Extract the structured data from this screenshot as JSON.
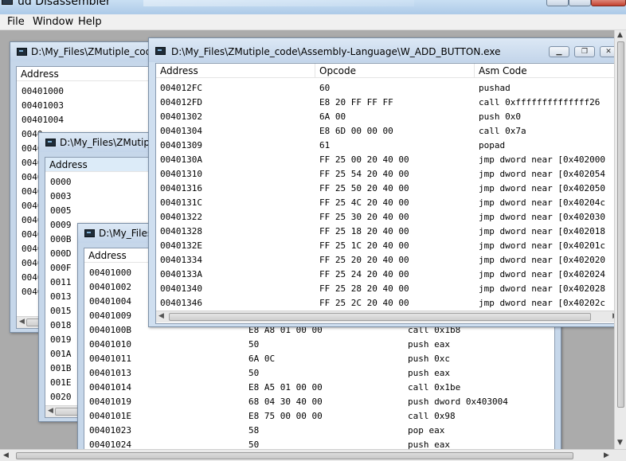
{
  "app": {
    "title": "ud Disassembler"
  },
  "menu": [
    "File",
    "Window",
    "Help"
  ],
  "windows": {
    "w1": {
      "title": "D:\\My_Files\\ZMutiple_code",
      "header": "Address",
      "addresses": [
        "00401000",
        "00401003",
        "00401004",
        "0040",
        "0040",
        "0040",
        "0040",
        "0040",
        "0040",
        "0040",
        "0040",
        "0040",
        "0040",
        "0040",
        "0040"
      ]
    },
    "w2": {
      "title": "D:\\My_Files\\ZMutipl",
      "header": "Address",
      "addresses": [
        "0000",
        "0003",
        "0005",
        "0009",
        "000B",
        "000D",
        "000F",
        "0011",
        "0013",
        "0015",
        "0018",
        "0019",
        "001A",
        "001B",
        "001E",
        "0020"
      ]
    },
    "w3": {
      "title": "D:\\My_Files",
      "header": "Address",
      "rows": [
        {
          "addr": "00401000",
          "op": "",
          "asm": ""
        },
        {
          "addr": "00401002",
          "op": "",
          "asm": ""
        },
        {
          "addr": "00401004",
          "op": "",
          "asm": ""
        },
        {
          "addr": "00401009",
          "op": "",
          "asm": ""
        },
        {
          "addr": "0040100B",
          "op": "E8 A8 01 00 00",
          "asm": "call 0x1b8"
        },
        {
          "addr": "00401010",
          "op": "50",
          "asm": "push eax"
        },
        {
          "addr": "00401011",
          "op": "6A 0C",
          "asm": "push 0xc"
        },
        {
          "addr": "00401013",
          "op": "50",
          "asm": "push eax"
        },
        {
          "addr": "00401014",
          "op": "E8 A5 01 00 00",
          "asm": "call 0x1be"
        },
        {
          "addr": "00401019",
          "op": "68 04 30 40 00",
          "asm": "push dword 0x403004"
        },
        {
          "addr": "0040101E",
          "op": "E8 75 00 00 00",
          "asm": "call 0x98"
        },
        {
          "addr": "00401023",
          "op": "58",
          "asm": "pop eax"
        },
        {
          "addr": "00401024",
          "op": "50",
          "asm": "push eax"
        }
      ]
    },
    "w4": {
      "title": "D:\\My_Files\\ZMutiple_code\\Assembly-Language\\W_ADD_BUTTON.exe",
      "headers": {
        "address": "Address",
        "opcode": "Opcode",
        "asm": "Asm Code"
      },
      "rows": [
        {
          "addr": "004012FC",
          "op": "60",
          "asm": "pushad"
        },
        {
          "addr": "004012FD",
          "op": "E8 20 FF FF FF",
          "asm": "call 0xffffffffffffff26"
        },
        {
          "addr": "00401302",
          "op": "6A 00",
          "asm": "push 0x0"
        },
        {
          "addr": "00401304",
          "op": "E8 6D 00 00 00",
          "asm": "call 0x7a"
        },
        {
          "addr": "00401309",
          "op": "61",
          "asm": "popad"
        },
        {
          "addr": "0040130A",
          "op": "FF 25 00 20 40 00",
          "asm": "jmp dword near [0x402000"
        },
        {
          "addr": "00401310",
          "op": "FF 25 54 20 40 00",
          "asm": "jmp dword near [0x402054"
        },
        {
          "addr": "00401316",
          "op": "FF 25 50 20 40 00",
          "asm": "jmp dword near [0x402050"
        },
        {
          "addr": "0040131C",
          "op": "FF 25 4C 20 40 00",
          "asm": "jmp dword near [0x40204c"
        },
        {
          "addr": "00401322",
          "op": "FF 25 30 20 40 00",
          "asm": "jmp dword near [0x402030"
        },
        {
          "addr": "00401328",
          "op": "FF 25 18 20 40 00",
          "asm": "jmp dword near [0x402018"
        },
        {
          "addr": "0040132E",
          "op": "FF 25 1C 20 40 00",
          "asm": "jmp dword near [0x40201c"
        },
        {
          "addr": "00401334",
          "op": "FF 25 20 20 40 00",
          "asm": "jmp dword near [0x402020"
        },
        {
          "addr": "0040133A",
          "op": "FF 25 24 20 40 00",
          "asm": "jmp dword near [0x402024"
        },
        {
          "addr": "00401340",
          "op": "FF 25 28 20 40 00",
          "asm": "jmp dword near [0x402028"
        },
        {
          "addr": "00401346",
          "op": "FF 25 2C 20 40 00",
          "asm": "jmp dword near [0x40202c"
        }
      ]
    }
  }
}
